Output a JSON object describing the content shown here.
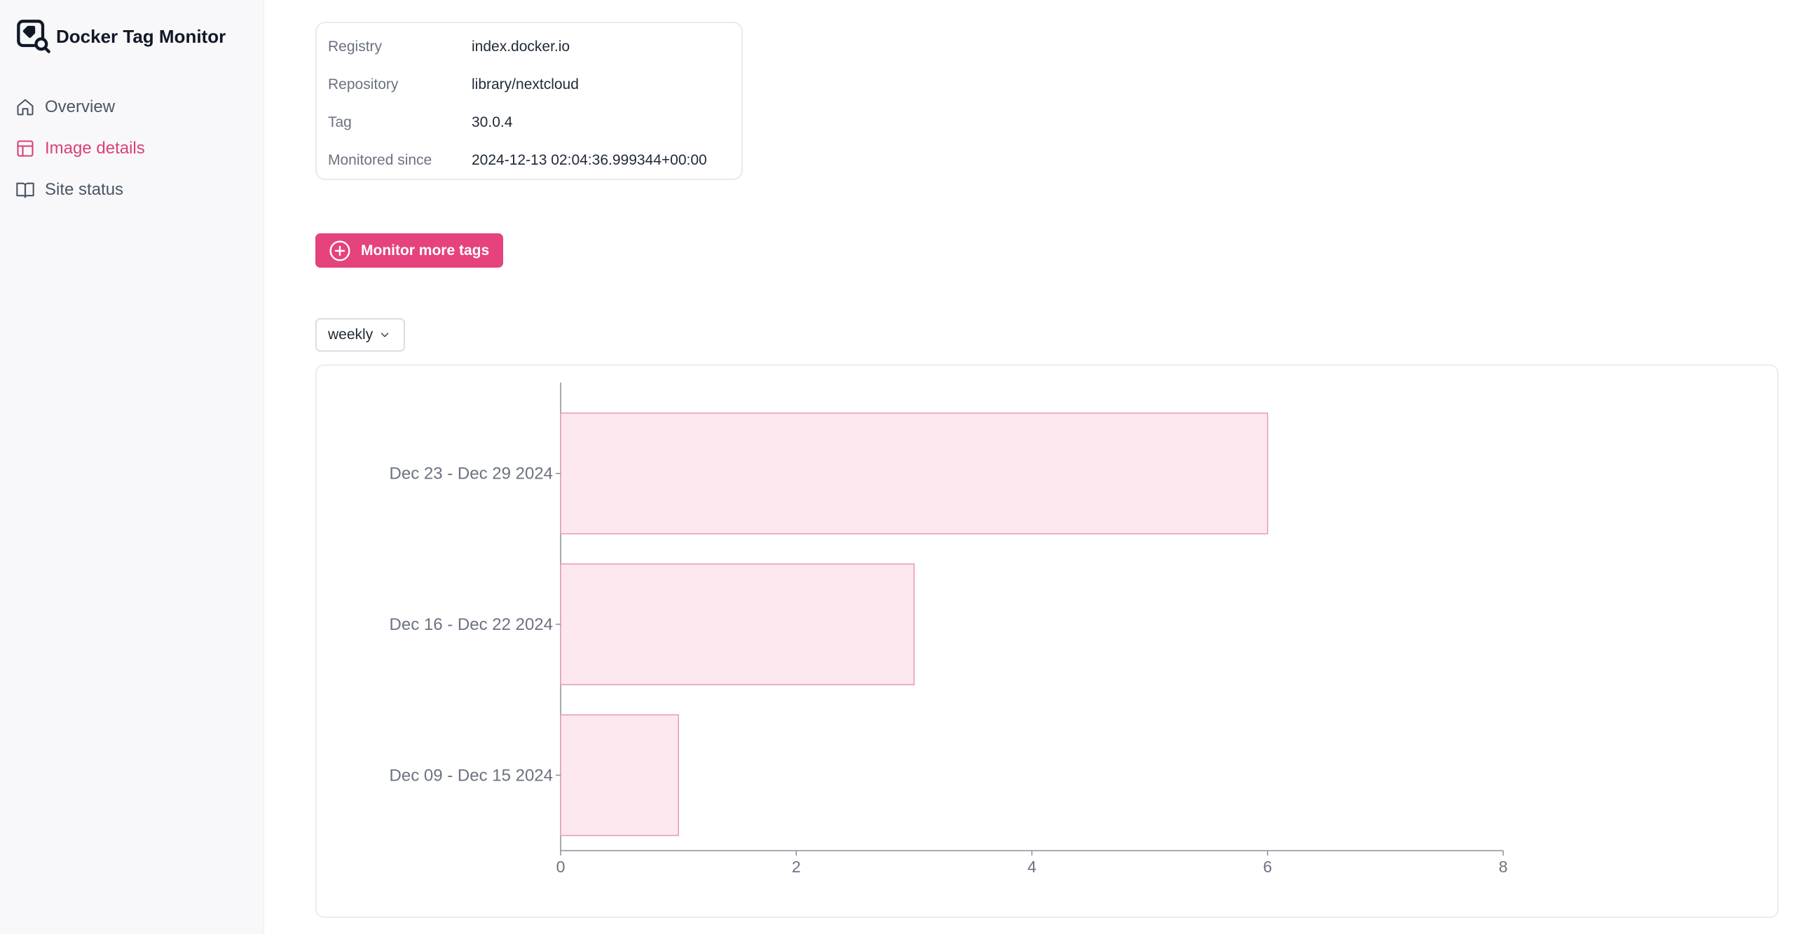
{
  "app": {
    "title": "Docker Tag Monitor",
    "logo_icon": "docker-tag-search-icon"
  },
  "sidebar": {
    "items": [
      {
        "label": "Overview",
        "icon": "home-icon",
        "active": false
      },
      {
        "label": "Image details",
        "icon": "table-icon",
        "active": true
      },
      {
        "label": "Site status",
        "icon": "book-open-icon",
        "active": false
      }
    ]
  },
  "details": {
    "rows": [
      {
        "key": "Registry",
        "value": "index.docker.io"
      },
      {
        "key": "Repository",
        "value": "library/nextcloud"
      },
      {
        "key": "Tag",
        "value": "30.0.4"
      },
      {
        "key": "Monitored since",
        "value": "2024-12-13 02:04:36.999344+00:00"
      }
    ]
  },
  "monitor_button": {
    "label": "Monitor more tags",
    "icon": "plus-circle-icon"
  },
  "period_select": {
    "value": "weekly",
    "icon": "chevron-down-icon"
  },
  "colors": {
    "accent": "#e5427e",
    "bar_fill": "#fde8ef",
    "bar_stroke": "#e79ab3"
  },
  "chart_data": {
    "type": "bar",
    "orientation": "horizontal",
    "categories": [
      "Dec 23 - Dec 29 2024",
      "Dec 16 - Dec 22 2024",
      "Dec 09 - Dec 15 2024"
    ],
    "values": [
      6,
      3,
      1
    ],
    "xlim": [
      0,
      8
    ],
    "xticks": [
      0,
      2,
      4,
      6,
      8
    ],
    "grid": false
  }
}
